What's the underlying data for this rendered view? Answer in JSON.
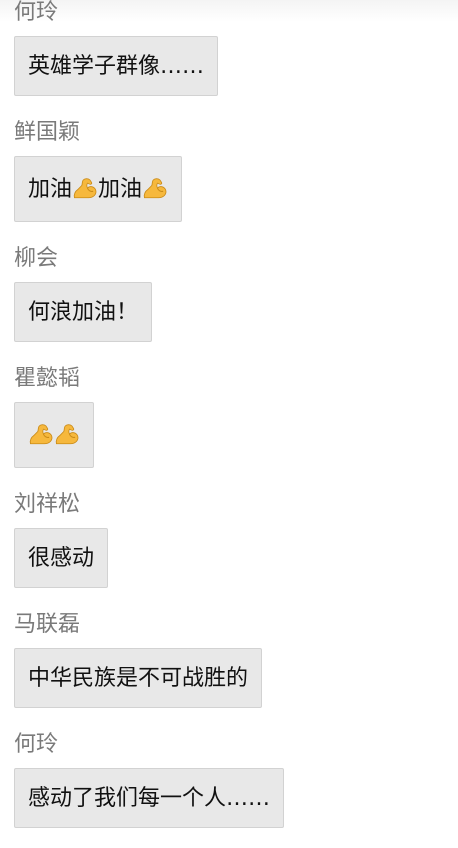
{
  "messages": [
    {
      "sender": "何玲",
      "parts": [
        {
          "type": "text",
          "text": "英雄学子群像……"
        }
      ]
    },
    {
      "sender": "鲜国颖",
      "parts": [
        {
          "type": "text",
          "text": "加油"
        },
        {
          "type": "emoji",
          "icon": "flexed-biceps-icon"
        },
        {
          "type": "text",
          "text": "加油"
        },
        {
          "type": "emoji",
          "icon": "flexed-biceps-icon"
        }
      ]
    },
    {
      "sender": "柳会",
      "parts": [
        {
          "type": "text",
          "text": "何浪加油！"
        }
      ]
    },
    {
      "sender": "瞿懿韬",
      "parts": [
        {
          "type": "emoji",
          "icon": "flexed-biceps-icon"
        },
        {
          "type": "emoji",
          "icon": "flexed-biceps-icon"
        }
      ]
    },
    {
      "sender": "刘祥松",
      "parts": [
        {
          "type": "text",
          "text": "很感动"
        }
      ]
    },
    {
      "sender": "马联磊",
      "parts": [
        {
          "type": "text",
          "text": "中华民族是不可战胜的"
        }
      ]
    },
    {
      "sender": "何玲",
      "parts": [
        {
          "type": "text",
          "text": "感动了我们每一个人……"
        }
      ]
    }
  ],
  "colors": {
    "sender_text": "#7a7a7a",
    "bubble_background": "#e8e8e8",
    "bubble_border": "#d2d2d2",
    "message_text": "#111111",
    "emoji_fill": "#f6b83d"
  }
}
